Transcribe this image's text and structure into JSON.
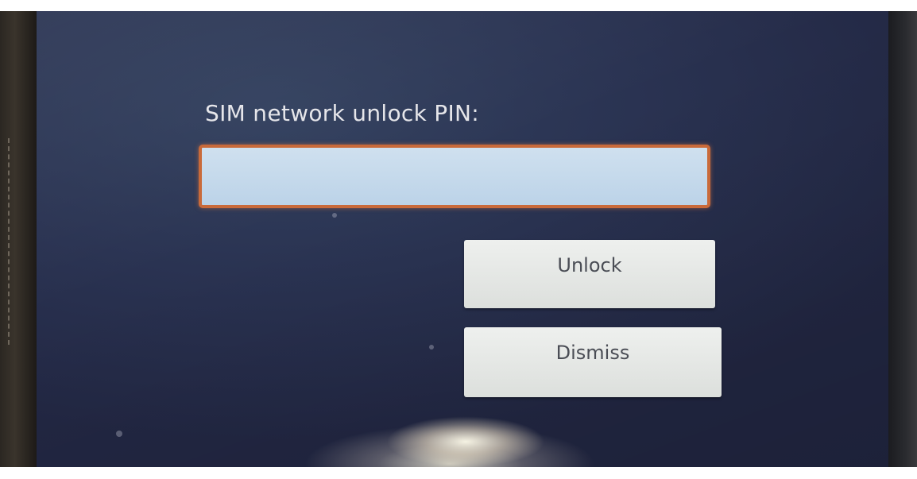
{
  "dialog": {
    "pin_label": "SIM network unlock PIN:",
    "pin_value": "",
    "unlock_label": "Unlock",
    "dismiss_label": "Dismiss"
  },
  "colors": {
    "screen_background": "#2a3352",
    "input_fill": "#c6d9eb",
    "input_focus_border": "#c96a3a",
    "button_fill": "#e4e7e4",
    "button_text": "#4a4d55",
    "label_text": "#e6e6ea"
  }
}
